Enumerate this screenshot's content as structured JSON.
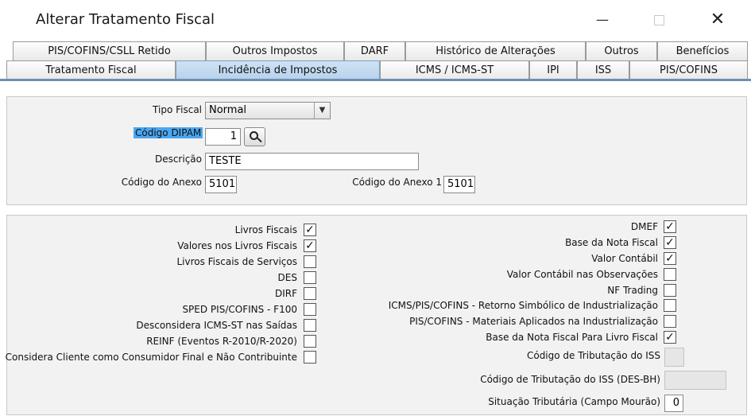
{
  "window": {
    "title": "Alterar Tratamento Fiscal",
    "minimize_glyph": "—",
    "close_glyph": "✕"
  },
  "tabs": {
    "row1": [
      "PIS/COFINS/CSLL Retido",
      "Outros Impostos",
      "DARF",
      "Histórico de Alterações",
      "Outros",
      "Benefícios"
    ],
    "row2": [
      "Tratamento Fiscal",
      "Incidência de Impostos",
      "ICMS / ICMS-ST",
      "IPI",
      "ISS",
      "PIS/COFINS"
    ],
    "active": "Incidência de Impostos"
  },
  "general": {
    "tipo_fiscal_label": "Tipo Fiscal",
    "tipo_fiscal_value": "Normal",
    "codigo_dipam_label": "Código DIPAM",
    "codigo_dipam_value": "1",
    "descricao_label": "Descrição",
    "descricao_value": "TESTE",
    "codigo_anexo_label": "Código do Anexo",
    "codigo_anexo_value": "5101",
    "codigo_anexo1_label": "Código do Anexo 1",
    "codigo_anexo1_value": "5101"
  },
  "checks_left": [
    {
      "label": "Livros Fiscais",
      "checked": true
    },
    {
      "label": "Valores nos Livros Fiscais",
      "checked": true
    },
    {
      "label": "Livros Fiscais de Serviços",
      "checked": false
    },
    {
      "label": "DES",
      "checked": false
    },
    {
      "label": "DIRF",
      "checked": false
    },
    {
      "label": "SPED PIS/COFINS - F100",
      "checked": false
    },
    {
      "label": "Desconsidera ICMS-ST nas Saídas",
      "checked": false
    },
    {
      "label": "REINF (Eventos R-2010/R-2020)",
      "checked": false
    },
    {
      "label": "Considera Cliente como Consumidor Final e Não Contribuinte",
      "checked": false
    }
  ],
  "checks_right": [
    {
      "label": "DMEF",
      "checked": true
    },
    {
      "label": "Base da Nota Fiscal",
      "checked": true
    },
    {
      "label": "Valor Contábil",
      "checked": true
    },
    {
      "label": "Valor Contábil nas Observações",
      "checked": false
    },
    {
      "label": "NF Trading",
      "checked": false
    },
    {
      "label": "ICMS/PIS/COFINS - Retorno Simbólico de Industrialização",
      "checked": false
    },
    {
      "label": "PIS/COFINS - Materiais Aplicados na Industrialização",
      "checked": false
    },
    {
      "label": "Base da Nota Fiscal Para Livro Fiscal",
      "checked": true
    }
  ],
  "iss": {
    "codigo_tributacao_label": "Código de Tributação do ISS",
    "codigo_tributacao_value": "",
    "codigo_tributacao_desbh_label": "Código de Tributação do ISS (DES-BH)",
    "codigo_tributacao_desbh_value": "",
    "situacao_tributaria_label": "Situação Tributária (Campo Mourão)",
    "situacao_tributaria_value": "0"
  },
  "check_glyph": "✓",
  "dropdown_glyph": "▼"
}
